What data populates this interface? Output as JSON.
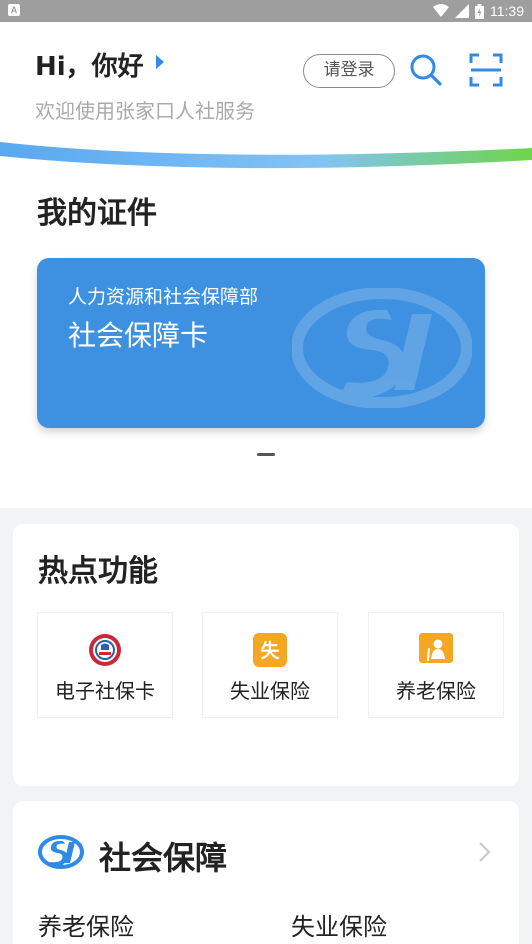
{
  "status_bar": {
    "notification_icon": "a-icon",
    "time": "11:39",
    "icons": [
      "wifi-icon",
      "signal-icon",
      "battery-icon"
    ]
  },
  "header": {
    "greeting": "Hi，你好",
    "welcome": "欢迎使用张家口人社服务",
    "login_label": "请登录",
    "search_icon": "search-icon",
    "scan_icon": "scan-icon",
    "colors": {
      "accent": "#2f8be6",
      "wave_blue": "#6db2f2",
      "wave_green": "#6fd44d"
    }
  },
  "certificates": {
    "title": "我的证件",
    "card": {
      "org": "人力资源和社会保障部",
      "name": "社会保障卡",
      "color": "#3e91e0"
    }
  },
  "hot_functions": {
    "title": "热点功能",
    "items": [
      {
        "label": "电子社保卡",
        "icon": "e-social-card-icon"
      },
      {
        "label": "失业保险",
        "icon": "unemployment-icon",
        "glyph": "失"
      },
      {
        "label": "养老保险",
        "icon": "pension-icon"
      }
    ]
  },
  "social_security": {
    "title": "社会保障",
    "items": [
      "养老保险",
      "失业保险"
    ]
  }
}
